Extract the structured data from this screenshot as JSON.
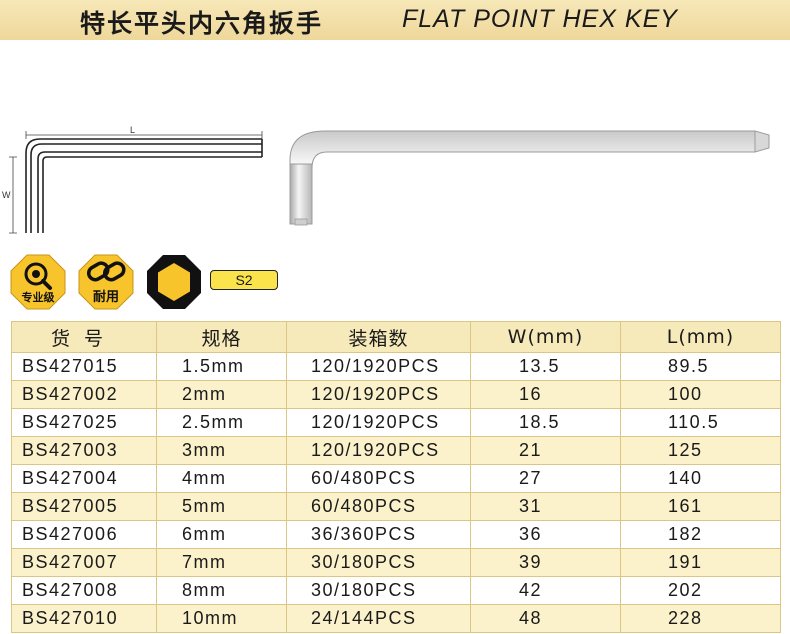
{
  "title": {
    "cn": "特长平头内六角扳手",
    "en": "FLAT POINT HEX KEY"
  },
  "diagram": {
    "length_label": "L",
    "width_label": "W"
  },
  "badges": {
    "professional": "专业级",
    "durable": "耐用",
    "material": "S2"
  },
  "colors": {
    "banner": "#f2dfa6",
    "header": "#f7eaba",
    "stripe": "#fbf1cb",
    "badge": "#f7c42b",
    "badge_dark": "#111111",
    "material_tag": "#fbe34c"
  },
  "table": {
    "headers": [
      "货号",
      "规格",
      "装箱数",
      "W(mm)",
      "L(mm)"
    ],
    "rows": [
      [
        "BS427015",
        "1.5mm",
        "120/1920PCS",
        "13.5",
        "89.5"
      ],
      [
        "BS427002",
        "2mm",
        "120/1920PCS",
        "16",
        "100"
      ],
      [
        "BS427025",
        "2.5mm",
        "120/1920PCS",
        "18.5",
        "110.5"
      ],
      [
        "BS427003",
        "3mm",
        "120/1920PCS",
        "21",
        "125"
      ],
      [
        "BS427004",
        "4mm",
        "60/480PCS",
        "27",
        "140"
      ],
      [
        "BS427005",
        "5mm",
        "60/480PCS",
        "31",
        "161"
      ],
      [
        "BS427006",
        "6mm",
        "36/360PCS",
        "36",
        "182"
      ],
      [
        "BS427007",
        "7mm",
        "30/180PCS",
        "39",
        "191"
      ],
      [
        "BS427008",
        "8mm",
        "30/180PCS",
        "42",
        "202"
      ],
      [
        "BS427010",
        "10mm",
        "24/144PCS",
        "48",
        "228"
      ]
    ]
  }
}
